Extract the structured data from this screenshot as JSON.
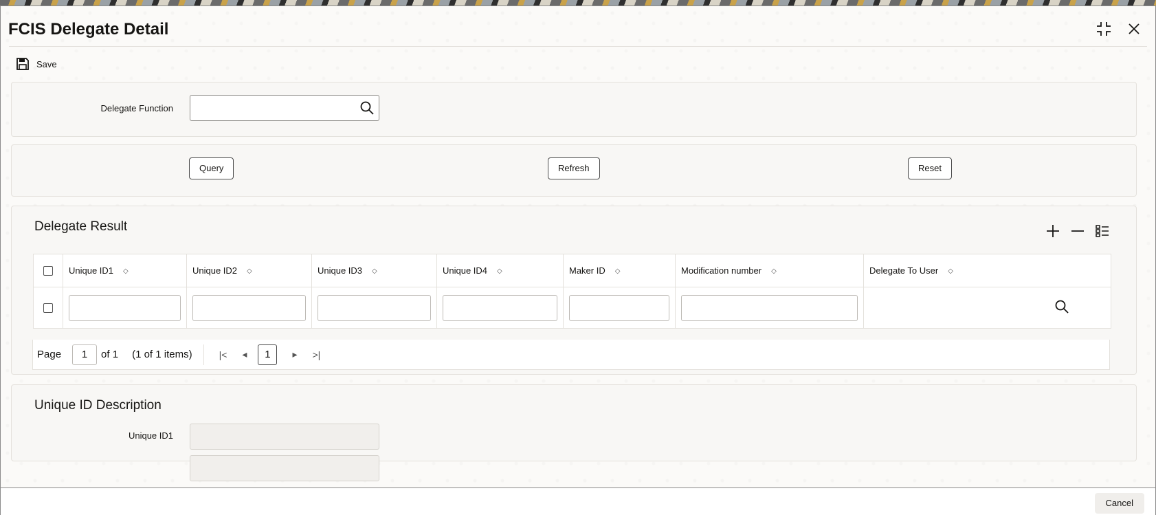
{
  "window": {
    "title": "FCIS Delegate Detail"
  },
  "toolbar": {
    "save_label": "Save"
  },
  "filter": {
    "delegate_function_label": "Delegate Function",
    "delegate_function_value": ""
  },
  "actions": {
    "query_label": "Query",
    "refresh_label": "Refresh",
    "reset_label": "Reset"
  },
  "result": {
    "title": "Delegate Result",
    "columns": [
      "Unique ID1",
      "Unique ID2",
      "Unique ID3",
      "Unique ID4",
      "Maker ID",
      "Modification number",
      "Delegate To User"
    ],
    "pager": {
      "page_label": "Page",
      "current_page": "1",
      "of_label": "of 1",
      "items_label": "(1 of 1 items)",
      "page_button": "1"
    }
  },
  "description": {
    "title": "Unique ID Description",
    "unique_id1_label": "Unique ID1"
  },
  "footer": {
    "cancel_label": "Cancel"
  },
  "colors": {
    "accent_text": "#161513",
    "panel_bg": "#f8f7f5",
    "border": "#e4e1dc"
  }
}
